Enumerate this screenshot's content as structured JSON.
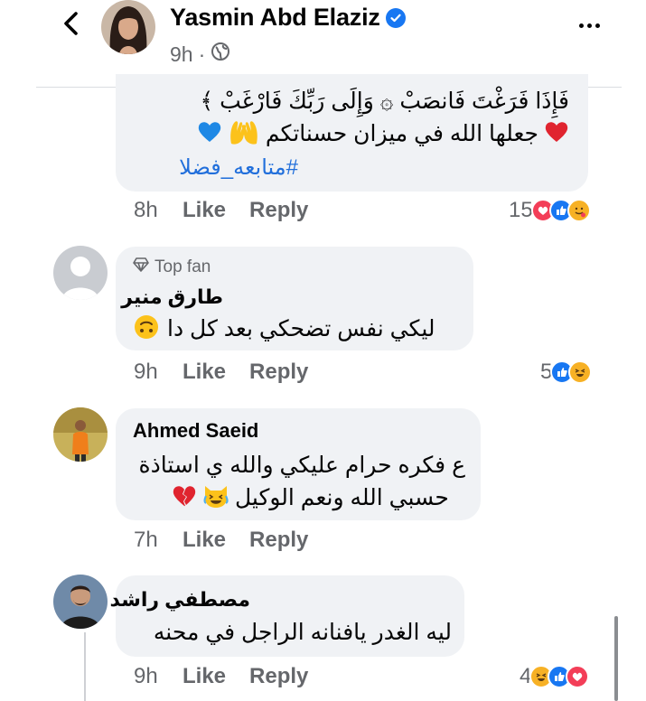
{
  "header": {
    "name": "Yasmin Abd Elaziz",
    "time": "9h",
    "dot": "·",
    "audience_icon": "globe-icon",
    "more_icon": "more-horizontal-icon",
    "back_icon": "chevron-left-icon",
    "verified_icon": "verified-badge-icon"
  },
  "comments": [
    {
      "lines": [
        "فَإِذَا فَرَغْتَ فَانصَبْ ۞ وَإِلَى رَبِّكَ فَارْغَبْ ﴾",
        "جعلها الله في ميزان حسناتكم",
        "#متابعه_فضلا"
      ],
      "time": "8h",
      "like": "Like",
      "reply": "Reply",
      "reaction_count": "15",
      "reactions": [
        "love",
        "like",
        "hug"
      ]
    },
    {
      "badge": "Top fan",
      "author": "طارق منير",
      "text": "ليكي نفس تضحكي بعد كل دا",
      "time": "9h",
      "like": "Like",
      "reply": "Reply",
      "reaction_count": "5",
      "reactions": [
        "like",
        "haha"
      ]
    },
    {
      "author": "Ahmed Saeid",
      "lines": [
        "ع فكره حرام عليكي والله ي استاذة",
        "حسبي الله ونعم الوكيل"
      ],
      "time": "7h",
      "like": "Like",
      "reply": "Reply"
    },
    {
      "author": "مصطفي راشد",
      "text": "ليه الغدر يافنانه الراجل في محنه",
      "time": "9h",
      "like": "Like",
      "reply": "Reply",
      "reaction_count": "4",
      "reactions": [
        "haha",
        "like",
        "love"
      ]
    }
  ],
  "colors": {
    "accent": "#1877f2",
    "bubble": "#f0f2f5",
    "secondary_text": "#65676b",
    "hashtag": "#216fdb",
    "love": "#f33e58",
    "haha": "#f7b125"
  }
}
